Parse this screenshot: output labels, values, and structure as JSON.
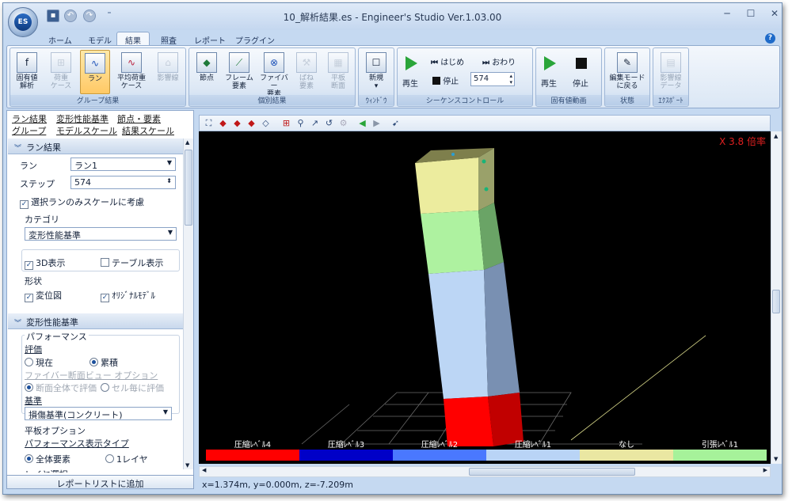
{
  "window": {
    "title": "10_解析結果.es - Engineer's Studio Ver.1.03.00",
    "logo": "ES"
  },
  "quick_access": [
    "save-icon",
    "undo-icon",
    "redo-icon",
    "customize-icon"
  ],
  "window_controls": [
    "─",
    "☐",
    "✕"
  ],
  "tabs": [
    {
      "label": "ホーム"
    },
    {
      "label": "モデル"
    },
    {
      "label": "結果"
    },
    {
      "label": "照査"
    },
    {
      "label": "レポート"
    },
    {
      "label": "プラグイン"
    }
  ],
  "active_tab": "結果",
  "ribbon": {
    "group_results": {
      "label": "グループ結果",
      "buttons": [
        {
          "label1": "固有値",
          "label2": "解析",
          "icon": "eigen-icon",
          "enabled": true
        },
        {
          "label1": "荷重",
          "label2": "ケース",
          "icon": "loadcase-icon",
          "enabled": false
        },
        {
          "label1": "ラン",
          "label2": "",
          "icon": "run-icon",
          "enabled": true,
          "selected": true
        },
        {
          "label1": "平均荷重",
          "label2": "ケース",
          "icon": "avg-load-icon",
          "enabled": true
        },
        {
          "label1": "影響線",
          "label2": "",
          "icon": "influence-line-icon",
          "enabled": false
        }
      ]
    },
    "individual": {
      "label": "個別結果",
      "buttons": [
        {
          "label1": "節点",
          "label2": "",
          "icon": "node-icon",
          "enabled": true
        },
        {
          "label1": "フレーム",
          "label2": "要素",
          "icon": "frame-element-icon",
          "enabled": true
        },
        {
          "label1": "ファイバー",
          "label2": "要素",
          "icon": "fiber-element-icon",
          "enabled": true
        },
        {
          "label1": "ばね",
          "label2": "要素",
          "icon": "spring-element-icon",
          "enabled": false
        },
        {
          "label1": "平板",
          "label2": "断面",
          "icon": "plate-section-icon",
          "enabled": false
        }
      ]
    },
    "window": {
      "label": "ｳｨﾝﾄﾞｳ",
      "new_label": "新規"
    },
    "sequence": {
      "label": "シーケンスコントロール",
      "play": "再生",
      "begin": "はじめ",
      "end": "おわり",
      "stop": "停止",
      "step": "574"
    },
    "eigen_anim": {
      "label": "固有値動画",
      "play": "再生",
      "stop": "停止"
    },
    "state": {
      "label": "状態",
      "edit1": "編集モード",
      "edit2": "に戻る"
    },
    "export": {
      "label": "ｴｸｽﾎﾟｰﾄ",
      "inf1": "影響線",
      "inf2": "データ"
    }
  },
  "left": {
    "links": [
      "ラン結果",
      "変形性能基準",
      "節点・要素",
      "グループ",
      "モデルスケール",
      "結果スケール"
    ],
    "section1": "ラン結果",
    "run_label": "ラン",
    "run_value": "ラン1",
    "step_label": "ステップ",
    "step_value": "574",
    "consider_scale": "選択ランのみスケールに考慮",
    "category_label": "カテゴリ",
    "category_value": "変形性能基準",
    "view3d": "3D表示",
    "table_view": "テーブル表示",
    "shape_label": "形状",
    "displacement": "変位図",
    "original_model": "ｵﾘｼﾞﾅﾙﾓﾃﾞﾙ",
    "section2": "変形性能基準",
    "performance": "パフォーマンス",
    "eval": "評価",
    "now": "現在",
    "cumulative": "累積",
    "fiber_opt": "ファイバー断面ビュー オプション",
    "whole_sec": "断面全体で評価",
    "per_cell": "セル毎に評価",
    "criterion_label": "基準",
    "criterion_value": "損傷基準(コンクリート)",
    "plate_opt": "平板オプション",
    "perf_disp_type": "パフォーマンス表示タイプ",
    "all_elem": "全体要素",
    "one_layer": "1レイヤ",
    "layer_select": "レイヤ選択",
    "report_btn": "レポートリストに追加"
  },
  "viewport": {
    "scale": "X 3.8 倍率",
    "legend": [
      {
        "label": "圧縮ﾚﾍﾞﾙ4",
        "color": "#ff0000"
      },
      {
        "label": "圧縮ﾚﾍﾞﾙ3",
        "color": "#0000c8"
      },
      {
        "label": "圧縮ﾚﾍﾞﾙ2",
        "color": "#4a78ff"
      },
      {
        "label": "圧縮ﾚﾍﾞﾙ1",
        "color": "#b9d4f6"
      },
      {
        "label": "なし",
        "color": "#eae7a2"
      },
      {
        "label": "引張ﾚﾍﾞﾙ1",
        "color": "#a6f29a"
      }
    ]
  },
  "status": "x=1.374m, y=0.000m, z=-7.209m"
}
